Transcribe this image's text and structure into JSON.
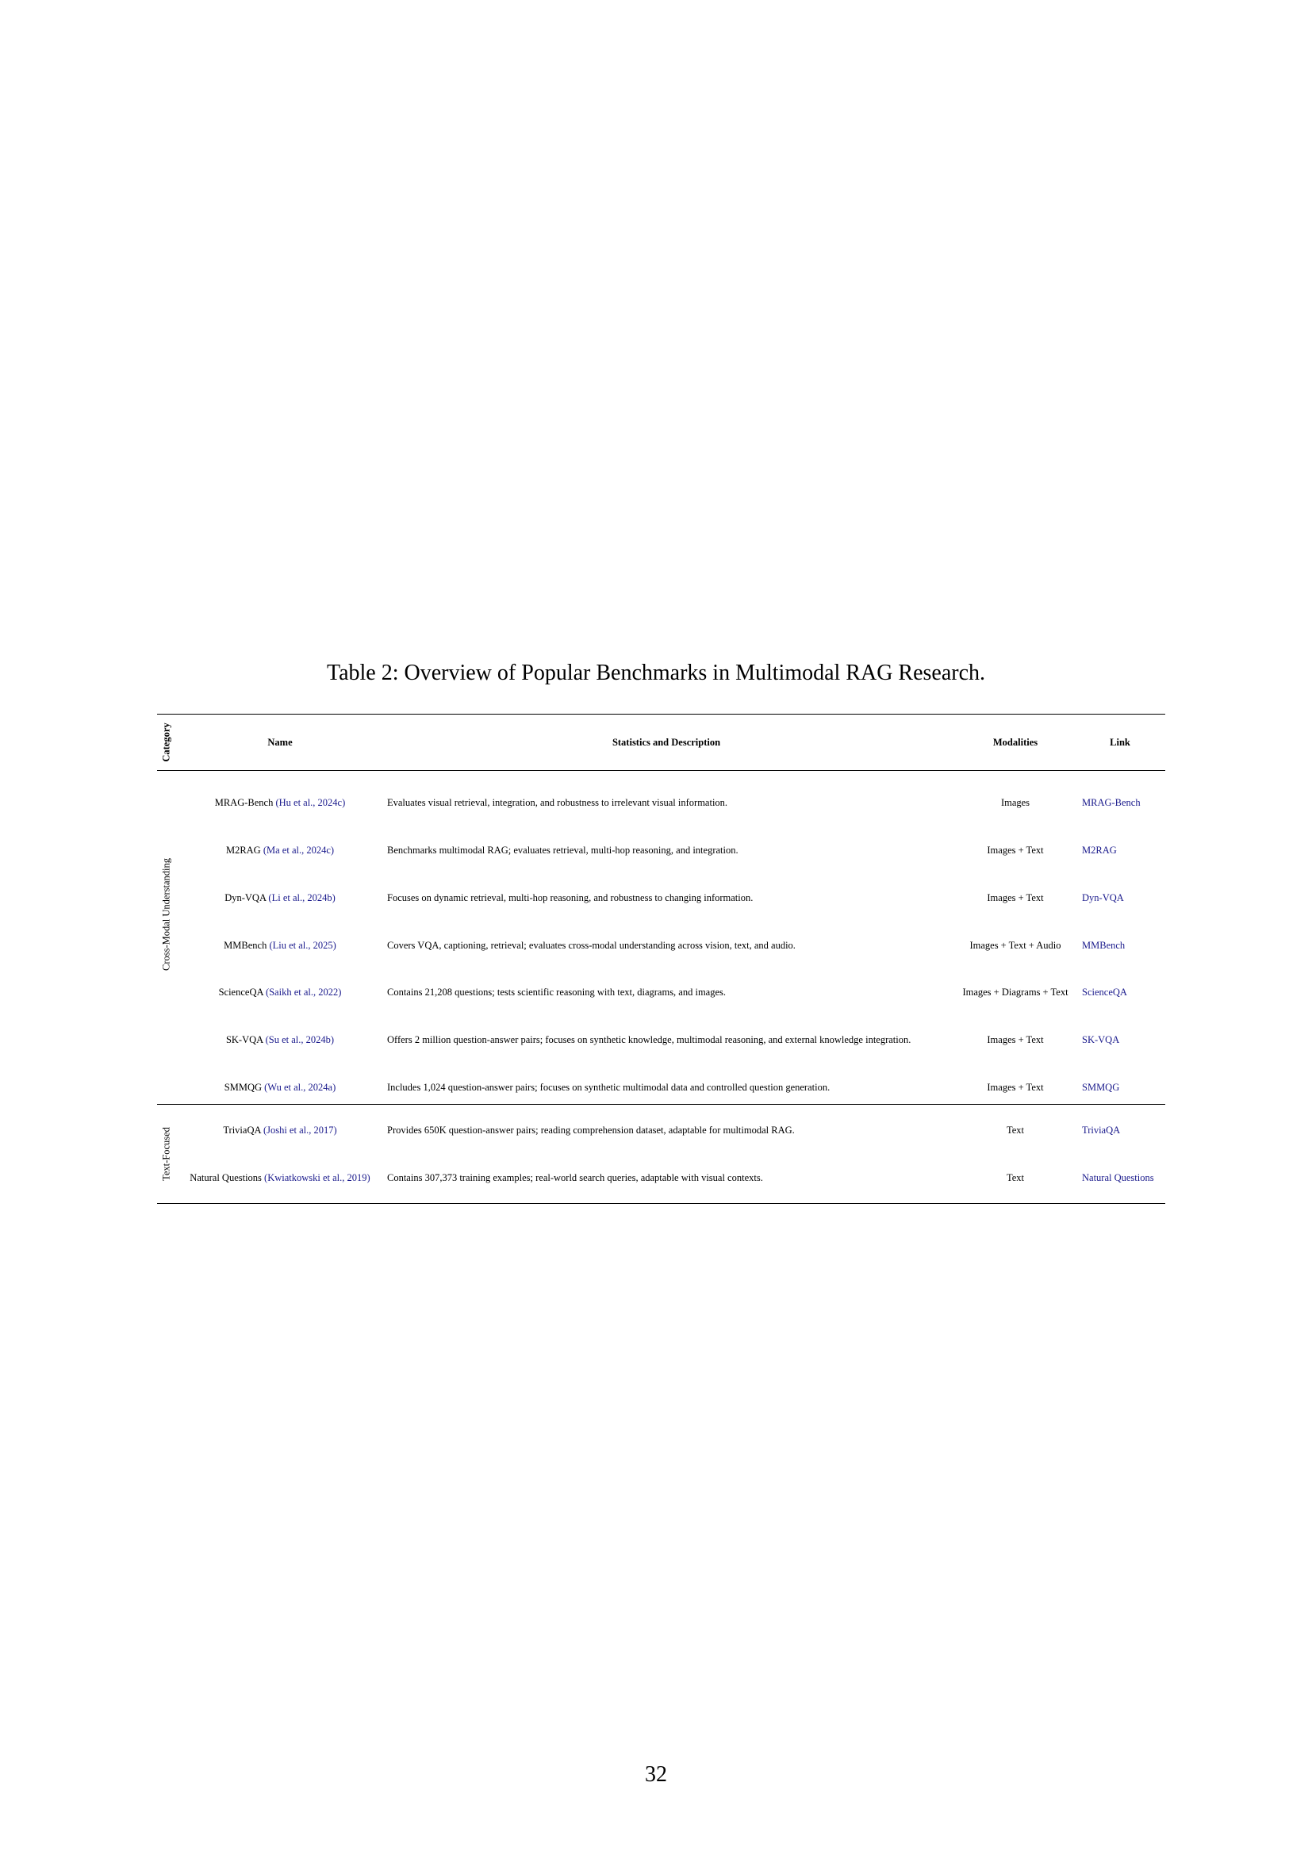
{
  "caption": "Table 2: Overview of Popular Benchmarks in Multimodal RAG Research.",
  "header": {
    "category": "Category",
    "name": "Name",
    "description": "Statistics and Description",
    "modalities": "Modalities",
    "link": "Link"
  },
  "sections": [
    {
      "category": "Cross-Modal Understanding",
      "rows": [
        {
          "name": "MRAG-Bench",
          "cite": "(Hu et al., 2024c)",
          "description": "Evaluates visual retrieval, integration, and robustness to irrelevant visual information.",
          "modalities": "Images",
          "link": "MRAG-Bench"
        },
        {
          "name": "M2RAG",
          "cite": "(Ma et al., 2024c)",
          "description": "Benchmarks multimodal RAG; evaluates retrieval, multi-hop reasoning, and integration.",
          "modalities": "Images + Text",
          "link": "M2RAG"
        },
        {
          "name": "Dyn-VQA",
          "cite": "(Li et al., 2024b)",
          "description": "Focuses on dynamic retrieval, multi-hop reasoning, and robustness to changing information.",
          "modalities": "Images + Text",
          "link": "Dyn-VQA"
        },
        {
          "name": "MMBench",
          "cite": "(Liu et al., 2025)",
          "description": "Covers VQA, captioning, retrieval; evaluates cross-modal understanding across vision, text, and audio.",
          "modalities": "Images + Text + Audio",
          "link": "MMBench"
        },
        {
          "name": "ScienceQA",
          "cite": "(Saikh et al., 2022)",
          "description": "Contains 21,208 questions; tests scientific reasoning with text, diagrams, and images.",
          "modalities": "Images + Diagrams + Text",
          "link": "ScienceQA"
        },
        {
          "name": "SK-VQA",
          "cite": "(Su et al., 2024b)",
          "description": "Offers 2 million question-answer pairs; focuses on synthetic knowledge, multimodal reasoning, and external knowledge integration.",
          "modalities": "Images + Text",
          "link": "SK-VQA"
        },
        {
          "name": "SMMQG",
          "cite": "(Wu et al., 2024a)",
          "description": "Includes 1,024 question-answer pairs; focuses on synthetic multimodal data and controlled question generation.",
          "modalities": "Images + Text",
          "link": "SMMQG"
        }
      ]
    },
    {
      "category": "Text-Focused",
      "rows": [
        {
          "name": "TriviaQA",
          "cite": "(Joshi et al., 2017)",
          "description": "Provides 650K question-answer pairs; reading comprehension dataset, adaptable for multimodal RAG.",
          "modalities": "Text",
          "link": "TriviaQA"
        },
        {
          "name": "Natural Questions",
          "cite": "(Kwiatkowski et al., 2019)",
          "description": "Contains 307,373 training examples; real-world search queries, adaptable with visual contexts.",
          "modalities": "Text",
          "link": "Natural Questions"
        }
      ]
    }
  ],
  "page_number": "32"
}
